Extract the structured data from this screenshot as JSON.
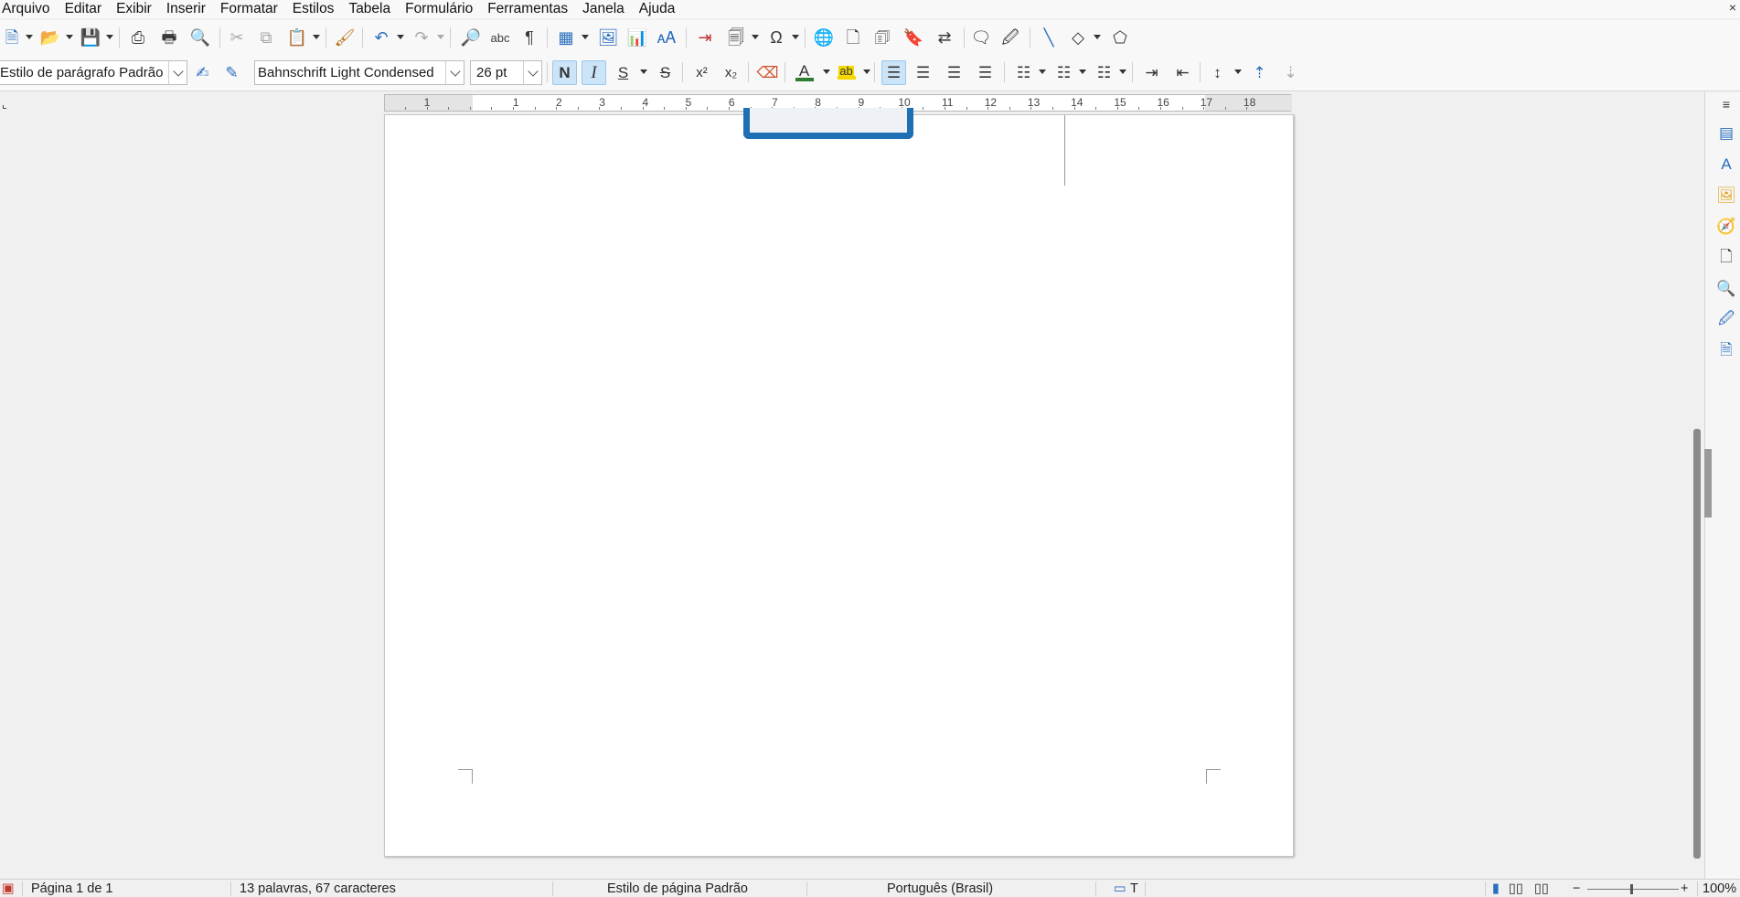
{
  "menu": [
    "Arquivo",
    "Editar",
    "Exibir",
    "Inserir",
    "Formatar",
    "Estilos",
    "Tabela",
    "Formulário",
    "Ferramentas",
    "Janela",
    "Ajuda"
  ],
  "menu_close": "×",
  "toolbar2": {
    "paragraph_style": "Estilo de parágrafo Padrão",
    "font_name": "Bahnschrift Light Condensed",
    "font_size": "26 pt",
    "bold": "N",
    "italic": "I",
    "underline": "S",
    "strikethrough": "S",
    "superscript": "x²",
    "subscript": "x₂",
    "font_color_letter": "A",
    "highlight_letter": "ab",
    "font_color": "#2e7d32",
    "highlight_color": "#f5d800"
  },
  "ruler": {
    "labels": [
      "1",
      "1",
      "2",
      "3",
      "4",
      "5",
      "6",
      "7",
      "8",
      "9",
      "10",
      "11",
      "12",
      "13",
      "14",
      "15",
      "16",
      "17",
      "18"
    ]
  },
  "status": {
    "page": "Página 1 de 1",
    "words": "13 palavras, 67 caracteres",
    "page_style": "Estilo de página Padrão",
    "language": "Português (Brasil)",
    "zoom": "100%"
  },
  "colors": {
    "accent": "#2a6ebd",
    "active_button": "#cce4f7"
  }
}
